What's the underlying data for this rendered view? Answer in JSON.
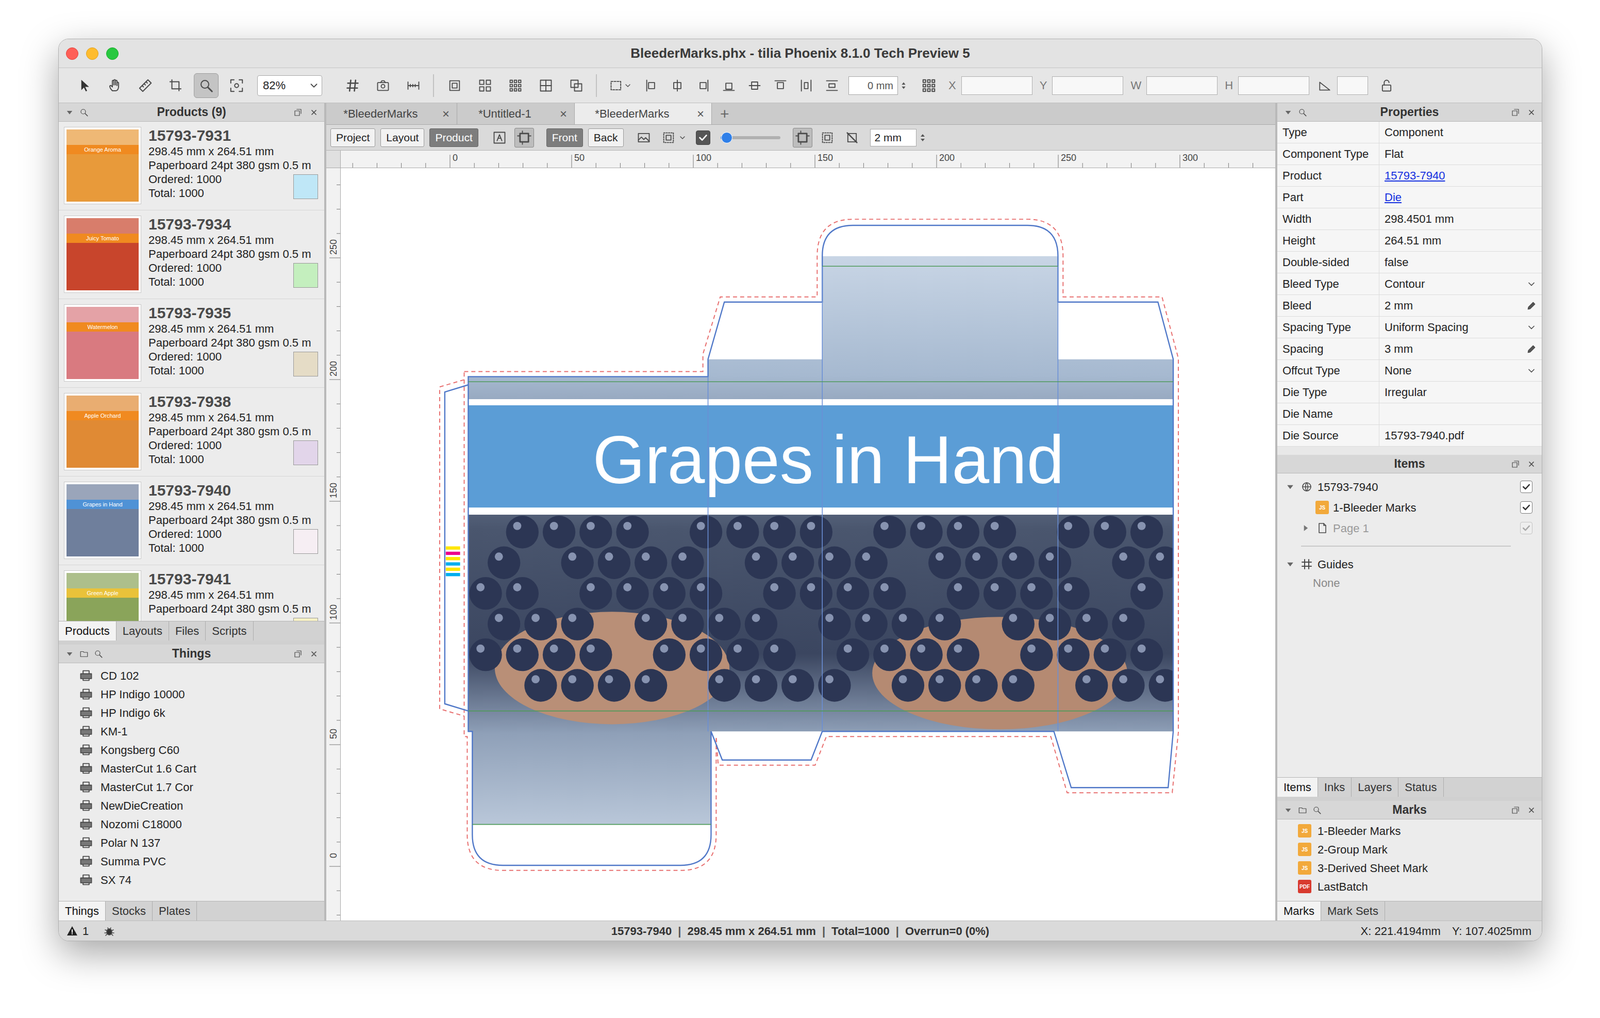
{
  "window": {
    "title": "BleederMarks.phx - tilia Phoenix 8.1.0 Tech Preview 5"
  },
  "toolbar": {
    "tools": [
      {
        "selected": false
      },
      {
        "selected": false
      },
      {
        "selected": false
      },
      {
        "selected": false
      },
      {
        "selected": true
      },
      {
        "selected": false
      }
    ],
    "zoom": "82%",
    "offset": "0 mm",
    "fields": [
      {
        "label": "X",
        "value": ""
      },
      {
        "label": "Y",
        "value": ""
      },
      {
        "label": "W",
        "value": ""
      },
      {
        "label": "H",
        "value": ""
      }
    ],
    "angle_value": ""
  },
  "products_panel": {
    "title": "Products (9)",
    "items": [
      {
        "name": "15793-7931",
        "size": "298.45 mm x 264.51 mm",
        "material": "Paperboard 24pt 380 gsm 0.5 m",
        "ordered": "Ordered: 1000",
        "total": "Total: 1000",
        "swatch": "#bfe7f7",
        "thumb_color": "#e89a3a",
        "band_color": "#f08a20",
        "thumb_label": "Orange Aroma"
      },
      {
        "name": "15793-7934",
        "size": "298.45 mm x 264.51 mm",
        "material": "Paperboard 24pt 380 gsm 0.5 m",
        "ordered": "Ordered: 1000",
        "total": "Total: 1000",
        "swatch": "#c4efbe",
        "thumb_color": "#c8452c",
        "band_color": "#f08a20",
        "thumb_label": "Juicy Tomato"
      },
      {
        "name": "15793-7935",
        "size": "298.45 mm x 264.51 mm",
        "material": "Paperboard 24pt 380 gsm 0.5 m",
        "ordered": "Ordered: 1000",
        "total": "Total: 1000",
        "swatch": "#e5dcc6",
        "thumb_color": "#d97a80",
        "band_color": "#f08a20",
        "thumb_label": "Watermelon"
      },
      {
        "name": "15793-7938",
        "size": "298.45 mm x 264.51 mm",
        "material": "Paperboard 24pt 380 gsm 0.5 m",
        "ordered": "Ordered: 1000",
        "total": "Total: 1000",
        "swatch": "#e2d5ea",
        "thumb_color": "#e08a34",
        "band_color": "#f08a20",
        "thumb_label": "Apple Orchard"
      },
      {
        "name": "15793-7940",
        "size": "298.45 mm x 264.51 mm",
        "material": "Paperboard 24pt 380 gsm 0.5 m",
        "ordered": "Ordered: 1000",
        "total": "Total: 1000",
        "swatch": "#f6eef3",
        "thumb_color": "#6f7f9c",
        "band_color": "#4f92d6",
        "thumb_label": "Grapes in Hand"
      },
      {
        "name": "15793-7941",
        "size": "298.45 mm x 264.51 mm",
        "material": "Paperboard 24pt 380 gsm 0.5 m",
        "swatch": "#f7f1c4",
        "thumb_color": "#8aa45a",
        "band_color": "#e9c23a",
        "thumb_label": "Green Apple"
      }
    ],
    "tabs": [
      {
        "label": "Products",
        "selected": true
      },
      {
        "label": "Layouts",
        "selected": false
      },
      {
        "label": "Files",
        "selected": false
      },
      {
        "label": "Scripts",
        "selected": false
      }
    ]
  },
  "things_panel": {
    "title": "Things",
    "items": [
      "CD 102",
      "HP Indigo 10000",
      "HP Indigo 6k",
      "KM-1",
      "Kongsberg C60",
      "MasterCut 1.6 Cart",
      "MasterCut 1.7 Cor",
      "NewDieCreation",
      "Nozomi C18000",
      "Polar N 137",
      "Summa PVC",
      "SX 74"
    ],
    "tabs": [
      {
        "label": "Things",
        "selected": true
      },
      {
        "label": "Stocks",
        "selected": false
      },
      {
        "label": "Plates",
        "selected": false
      }
    ]
  },
  "document_tabs": {
    "tabs": [
      {
        "label": "*BleederMarks",
        "close": "×",
        "selected": false
      },
      {
        "label": "*Untitled-1",
        "close": "×",
        "selected": false
      },
      {
        "label": "*BleederMarks",
        "close": "×",
        "selected": true
      }
    ],
    "new_tab": "+"
  },
  "view_bar": {
    "modes": [
      {
        "label": "Project",
        "selected": false
      },
      {
        "label": "Layout",
        "selected": false
      },
      {
        "label": "Product",
        "selected": true
      }
    ],
    "sides": [
      {
        "label": "Front",
        "selected": true
      },
      {
        "label": "Back",
        "selected": false
      }
    ],
    "toggles": [
      {
        "selected": false
      },
      {
        "selected": true
      },
      {
        "selected": false
      },
      {
        "selected": false
      },
      {
        "selected": true
      },
      {
        "selected": false
      },
      {
        "selected": false
      }
    ],
    "show_marks": true,
    "opacity_level": 0.05,
    "bleed": "2 mm"
  },
  "rulers": {
    "horizontal": [
      "0",
      "50",
      "100",
      "150",
      "200",
      "250",
      "300"
    ],
    "vertical": [
      "250",
      "200",
      "150",
      "100",
      "50",
      "0"
    ]
  },
  "canvas": {
    "artwork_title": "Grapes in Hand",
    "bleeder_marks": [
      {
        "color": "#ffe600"
      },
      {
        "color": "#ec008c"
      },
      {
        "color": "#ffe600"
      },
      {
        "color": "#00aeef"
      },
      {
        "color": "#ffe600"
      },
      {
        "color": "#00aeef"
      }
    ]
  },
  "properties": {
    "title": "Properties",
    "rows": [
      {
        "label": "Type",
        "value": "Component",
        "kind": "text"
      },
      {
        "label": "Component Type",
        "value": "Flat",
        "kind": "text"
      },
      {
        "label": "Product",
        "value": "15793-7940",
        "kind": "link"
      },
      {
        "label": "Part",
        "value": "Die",
        "kind": "link"
      },
      {
        "label": "Width",
        "value": "298.4501 mm",
        "kind": "text"
      },
      {
        "label": "Height",
        "value": "264.51 mm",
        "kind": "text"
      },
      {
        "label": "Double-sided",
        "value": "false",
        "kind": "text"
      },
      {
        "label": "Bleed Type",
        "value": "Contour",
        "kind": "select"
      },
      {
        "label": "Bleed",
        "value": "2 mm",
        "kind": "edit"
      },
      {
        "label": "Spacing Type",
        "value": "Uniform Spacing",
        "kind": "select"
      },
      {
        "label": "Spacing",
        "value": "3 mm",
        "kind": "edit"
      },
      {
        "label": "Offcut Type",
        "value": "None",
        "kind": "select"
      },
      {
        "label": "Die Type",
        "value": "Irregular",
        "kind": "text"
      },
      {
        "label": "Die Name",
        "value": "",
        "kind": "text"
      },
      {
        "label": "Die Source",
        "value": "15793-7940.pdf",
        "kind": "text"
      }
    ]
  },
  "items_panel": {
    "title": "Items",
    "tree": [
      {
        "label": "15793-7940",
        "kind": "product",
        "level": 0,
        "expanded": true,
        "checked": true,
        "disabled": false
      },
      {
        "label": "1-Bleeder Marks",
        "kind": "mark",
        "badge": "JS",
        "color": "#f2a93b",
        "level": 1,
        "checked": true,
        "disabled": false
      },
      {
        "label": "Page 1",
        "kind": "page",
        "level": 1,
        "expanded": false,
        "checked": true,
        "disabled": true
      }
    ],
    "guides": {
      "label": "Guides",
      "expanded": true,
      "empty": "None"
    },
    "tabs": [
      {
        "label": "Items",
        "selected": true
      },
      {
        "label": "Inks",
        "selected": false
      },
      {
        "label": "Layers",
        "selected": false
      },
      {
        "label": "Status",
        "selected": false
      }
    ]
  },
  "marks_panel": {
    "title": "Marks",
    "items": [
      {
        "label": "1-Bleeder Marks",
        "badge": "JS",
        "color": "#f2a93b"
      },
      {
        "label": "2-Group Mark",
        "badge": "JS",
        "color": "#f2a93b"
      },
      {
        "label": "3-Derived Sheet Mark",
        "badge": "JS",
        "color": "#f2a93b"
      },
      {
        "label": "LastBatch",
        "badge": "PDF",
        "color": "#d83a2e"
      }
    ],
    "tabs": [
      {
        "label": "Marks",
        "selected": true
      },
      {
        "label": "Mark Sets",
        "selected": false
      }
    ]
  },
  "status_bar": {
    "warnings": "1",
    "summary": [
      "15793-7940",
      "298.45 mm x 264.51 mm",
      "Total=1000",
      "Overrun=0 (0%)"
    ],
    "separator": "|",
    "x": "X: 221.4194mm",
    "y": "Y: 107.4025mm"
  }
}
